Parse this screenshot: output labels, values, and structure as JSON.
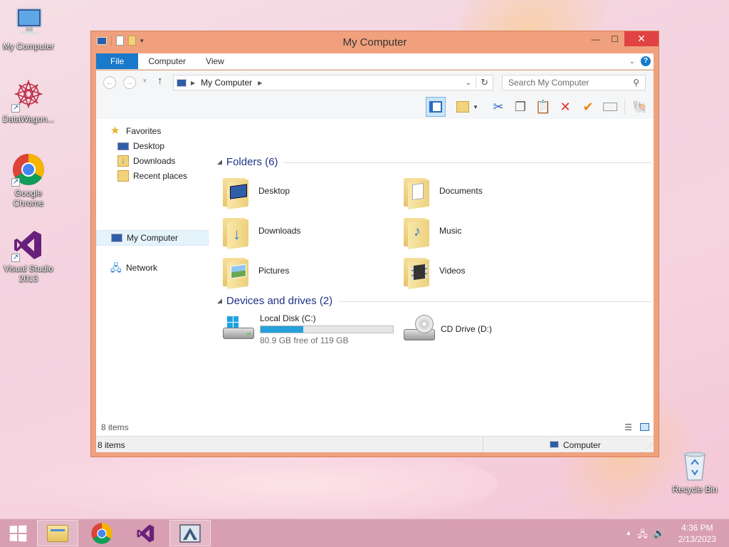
{
  "desktop": {
    "icons": [
      {
        "label": "My Computer"
      },
      {
        "label": "DataWagon..."
      },
      {
        "label": "Google Chrome"
      },
      {
        "label": "Visual Studio 2013"
      },
      {
        "label": "Recycle Bin"
      }
    ]
  },
  "window": {
    "title": "My Computer",
    "ribbon_tabs": {
      "file": "File",
      "computer": "Computer",
      "view": "View"
    },
    "address": {
      "path": "My Computer"
    },
    "search": {
      "placeholder": "Search My Computer"
    },
    "nav_pane": {
      "favorites": "Favorites",
      "desktop": "Desktop",
      "downloads": "Downloads",
      "recent": "Recent places",
      "my_computer": "My Computer",
      "network": "Network"
    },
    "folders_group": {
      "title": "Folders (6)",
      "items": [
        "Desktop",
        "Documents",
        "Downloads",
        "Music",
        "Pictures",
        "Videos"
      ]
    },
    "devices_group": {
      "title": "Devices and drives (2)",
      "local_disk": {
        "name": "Local Disk (C:)",
        "free": "80.9 GB free of 119 GB",
        "used_fraction": 0.32
      },
      "cd_drive": {
        "name": "CD Drive (D:)"
      }
    },
    "item_count_inner": "8 items",
    "status": {
      "count": "8 items",
      "location": "Computer"
    }
  },
  "taskbar": {
    "clock": {
      "time": "4:36 PM",
      "date": "2/13/2023"
    }
  },
  "colors": {
    "accent": "#1979ca",
    "close": "#e04343",
    "window_frame": "#f0a07c",
    "drive_fill": "#26a0da"
  }
}
